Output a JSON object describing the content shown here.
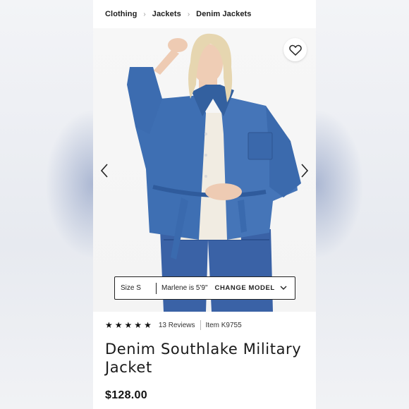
{
  "breadcrumb": {
    "items": [
      "Clothing",
      "Jackets",
      "Denim Jackets"
    ]
  },
  "photo": {
    "alt_icon": "wishlist-heart-icon"
  },
  "size_bar": {
    "size_label": "Size S",
    "model_text": "Marlene is 5'9\"",
    "change_label": "CHANGE MODEL"
  },
  "product": {
    "rating": 5,
    "reviews": "13 Reviews",
    "item": "Item K9755",
    "title": "Denim Southlake Military Jacket",
    "price": "$128.00"
  },
  "colors": {
    "denim": "#3f6fae",
    "text": "#1a1a1a"
  }
}
